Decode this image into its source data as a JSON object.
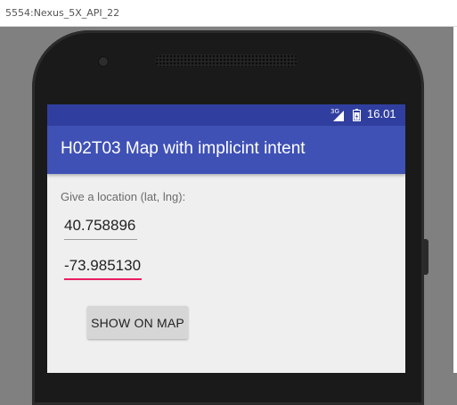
{
  "emulator": {
    "title": "5554:Nexus_5X_API_22"
  },
  "statusbar": {
    "network_type": "3G",
    "signal_icon": "cell-signal-icon",
    "battery_icon": "battery-icon",
    "time": "16.01"
  },
  "appbar": {
    "title": "H02T03 Map with implicint intent"
  },
  "form": {
    "prompt": "Give a location (lat, lng):",
    "latitude": "40.758896",
    "longitude": "-73.985130",
    "show_button_label": "SHOW ON MAP"
  },
  "colors": {
    "status_bar": "#303f9f",
    "app_bar": "#3f51b5",
    "focus_underline": "#e91e63",
    "screen_bg": "#efefef"
  }
}
